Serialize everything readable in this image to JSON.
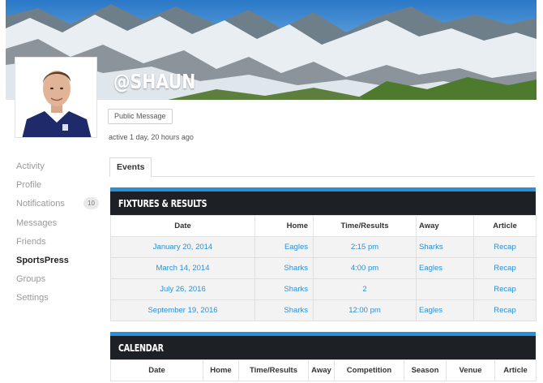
{
  "profile": {
    "username": "@SHAUN",
    "public_message_label": "Public Message",
    "activity_status": "active 1 day, 20 hours ago"
  },
  "sidebar": {
    "items": [
      {
        "label": "Activity"
      },
      {
        "label": "Profile"
      },
      {
        "label": "Notifications",
        "badge": "10"
      },
      {
        "label": "Messages"
      },
      {
        "label": "Friends"
      },
      {
        "label": "SportsPress"
      },
      {
        "label": "Groups"
      },
      {
        "label": "Settings"
      }
    ]
  },
  "tabs": {
    "events_label": "Events"
  },
  "fixtures": {
    "title": "FIXTURES & RESULTS",
    "headers": [
      "Date",
      "Home",
      "Time/Results",
      "Away",
      "Article"
    ],
    "rows": [
      [
        "January 20, 2014",
        "Eagles",
        "2:15 pm",
        "Sharks",
        "Recap"
      ],
      [
        "March 14, 2014",
        "Sharks",
        "4:00 pm",
        "Eagles",
        "Recap"
      ],
      [
        "July 26, 2016",
        "Sharks",
        "2",
        "",
        "Recap"
      ],
      [
        "September 19, 2016",
        "Sharks",
        "12:00 pm",
        "Eagles",
        "Recap"
      ]
    ]
  },
  "calendar": {
    "title": "CALENDAR",
    "headers": [
      "Date",
      "Home",
      "Time/Results",
      "Away",
      "Competition",
      "Season",
      "Venue",
      "Article"
    ]
  },
  "colors": {
    "accent": "#2b8fd6",
    "header_bg": "#1d2025"
  }
}
